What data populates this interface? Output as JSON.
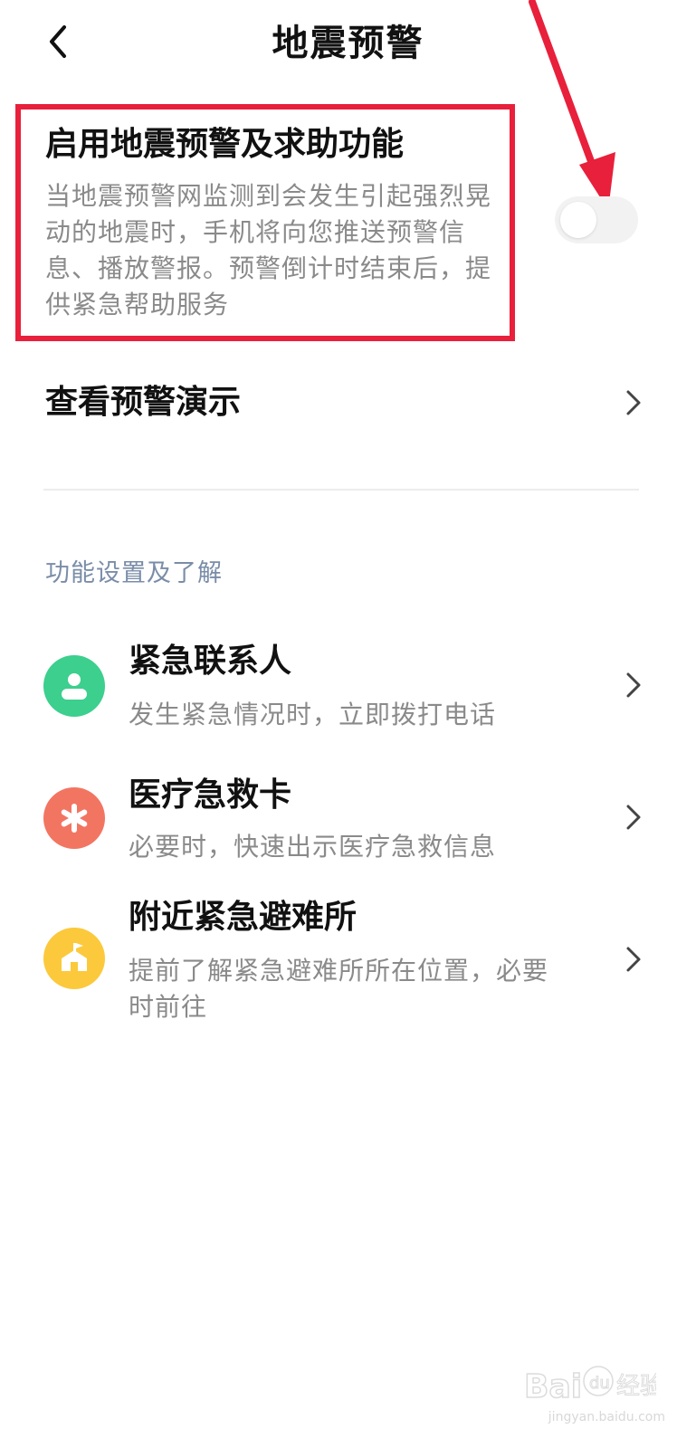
{
  "header": {
    "back_icon": "chevron-left-icon",
    "title": "地震预警"
  },
  "warning_toggle": {
    "title": "启用地震预警及求助功能",
    "description": "当地震预警网监测到会发生引起强烈晃动的地震时，手机将向您推送预警信息、播放警报。预警倒计时结束后，提供紧急帮助服务",
    "enabled": false,
    "highlight_color": "#e8203b"
  },
  "demo": {
    "label": "查看预警演示"
  },
  "section": {
    "title": "功能设置及了解"
  },
  "items": [
    {
      "title": "紧急联系人",
      "subtitle": "发生紧急情况时，立即拨打电话",
      "icon": "person-icon",
      "color": "#3ccf8e"
    },
    {
      "title": "医疗急救卡",
      "subtitle": "必要时，快速出示医疗急救信息",
      "icon": "asterisk-icon",
      "color": "#f27562"
    },
    {
      "title": "附近紧急避难所",
      "subtitle": "提前了解紧急避难所所在位置，必要时前往",
      "icon": "shelter-icon",
      "color": "#fbc93b"
    }
  ],
  "watermark": {
    "text": "jingyan.baidu.com"
  }
}
